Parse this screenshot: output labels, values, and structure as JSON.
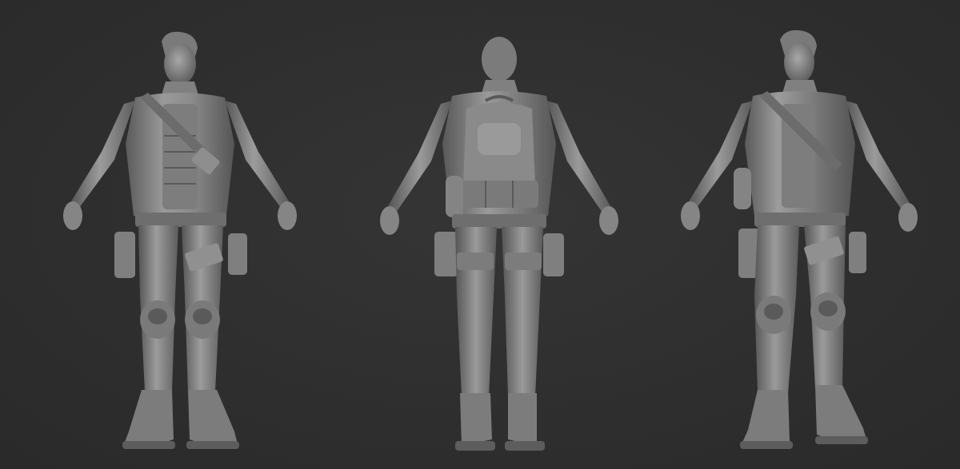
{
  "scene": {
    "background_color": "#2f2f2f",
    "material_color": "#8a8a8a",
    "highlight_color": "#bdbdbd",
    "shadow_color": "#4a4a4a",
    "views": [
      {
        "id": "front",
        "icon": "character-front-view"
      },
      {
        "id": "back",
        "icon": "character-back-view"
      },
      {
        "id": "three-quarter",
        "icon": "character-three-quarter-view"
      }
    ]
  }
}
